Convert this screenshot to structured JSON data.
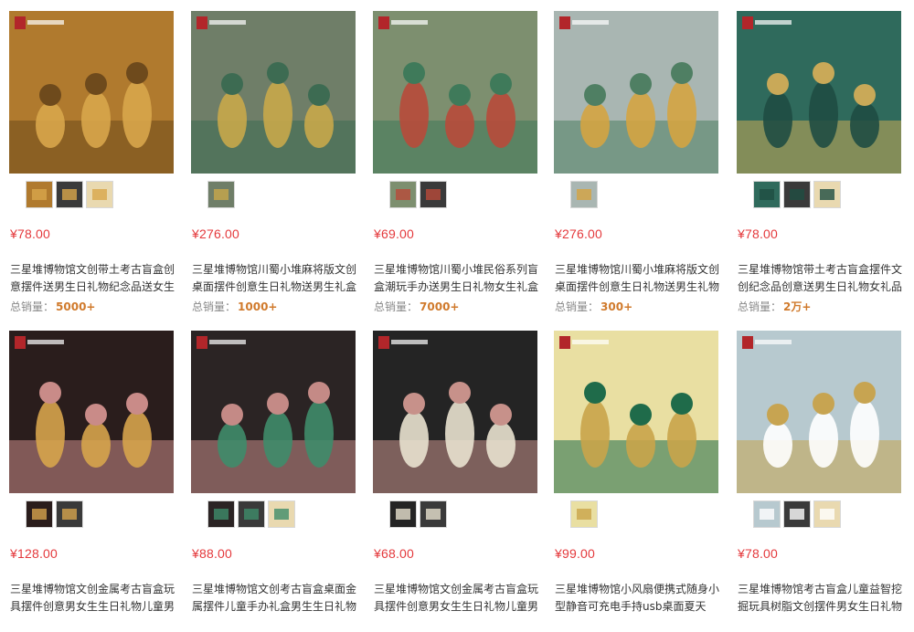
{
  "sales_label": "总销量：",
  "products": [
    {
      "price": "¥78.00",
      "title": "三星堆博物馆文创带土考古盲盒创意摆件送男生日礼物纪念品送女生",
      "sales": "5000+",
      "thumb_count": 3,
      "palette": {
        "bg": "#b07a2e",
        "fg": "#6e4a1c",
        "accent": "#d8a64b"
      }
    },
    {
      "price": "¥276.00",
      "title": "三星堆博物馆川蜀小堆麻将版文创桌面摆件创意生日礼物送男生礼盒",
      "sales": "1000+",
      "thumb_count": 1,
      "palette": {
        "bg": "#6f7e68",
        "fg": "#3d6b52",
        "accent": "#c8a84a"
      }
    },
    {
      "price": "¥69.00",
      "title": "三星堆博物馆川蜀小堆民俗系列盲盒潮玩手办送男生日礼物女生礼盒",
      "sales": "7000+",
      "thumb_count": 2,
      "palette": {
        "bg": "#7d8f6f",
        "fg": "#3f7a5a",
        "accent": "#b84a3a"
      }
    },
    {
      "price": "¥276.00",
      "title": "三星堆博物馆川蜀小堆麻将版文创桌面摆件创意生日礼物送男生礼物",
      "sales": "300+",
      "thumb_count": 1,
      "palette": {
        "bg": "#a9b6b2",
        "fg": "#4f7f63",
        "accent": "#d4a441"
      }
    },
    {
      "price": "¥78.00",
      "title": "三星堆博物馆带土考古盲盒摆件文创纪念品创意送男生日礼物女礼品",
      "sales": "2万+",
      "thumb_count": 3,
      "palette": {
        "bg": "#2f6a5c",
        "fg": "#c9a958",
        "accent": "#1f4d42"
      }
    },
    {
      "price": "¥128.00",
      "title": "三星堆博物馆文创金属考古盲盒玩具摆件创意男女生生日礼物儿童男女",
      "sales": "",
      "thumb_count": 2,
      "palette": {
        "bg": "#2a1d1c",
        "fg": "#c98b88",
        "accent": "#d6a44d"
      }
    },
    {
      "price": "¥88.00",
      "title": "三星堆博物馆文创考古盲盒桌面金属摆件儿童手办礼盒男生生日礼物",
      "sales": "",
      "thumb_count": 3,
      "palette": {
        "bg": "#2b2424",
        "fg": "#c48a86",
        "accent": "#3f8c6a"
      }
    },
    {
      "price": "¥68.00",
      "title": "三星堆博物馆文创金属考古盲盒玩具摆件创意男女生生日礼物儿童男女",
      "sales": "",
      "thumb_count": 2,
      "palette": {
        "bg": "#242424",
        "fg": "#c7918a",
        "accent": "#e9e2cf"
      }
    },
    {
      "price": "¥99.00",
      "title": "三星堆博物馆小风扇便携式随身小型静音可充电手持usb桌面夏天",
      "sales": "",
      "thumb_count": 1,
      "palette": {
        "bg": "#e9dfa2",
        "fg": "#1f6b4a",
        "accent": "#c9a44a"
      }
    },
    {
      "price": "¥78.00",
      "title": "三星堆博物馆考古盲盒儿童益智挖掘玩具树脂文创摆件男女生日礼物",
      "sales": "",
      "thumb_count": 3,
      "palette": {
        "bg": "#b7c9cf",
        "fg": "#c7a451",
        "accent": "#ffffff"
      }
    }
  ]
}
